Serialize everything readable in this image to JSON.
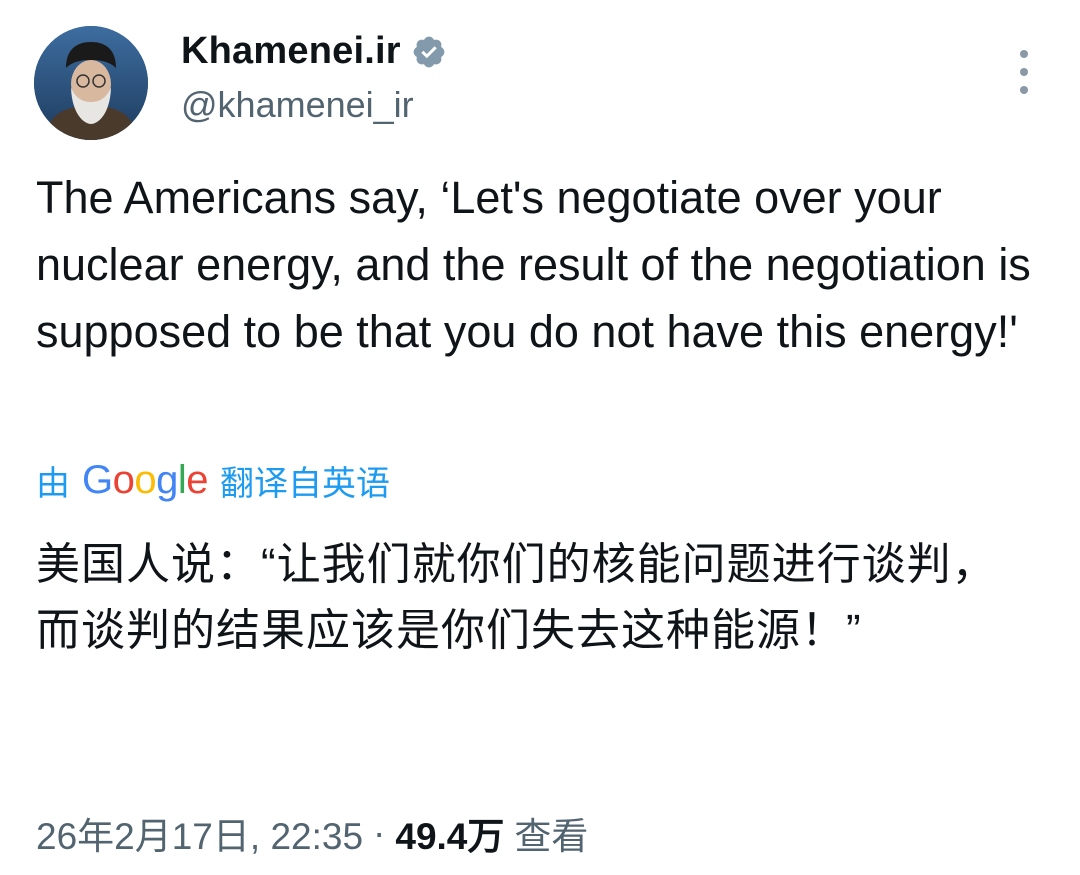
{
  "author": {
    "display_name": "Khamenei.ir",
    "handle": "@khamenei_ir",
    "verified_icon": "verified-badge-icon",
    "avatar": "profile-photo"
  },
  "tweet": {
    "text": "The Americans say, ‘Let's negotiate over your nuclear energy, and the result of the negotiation is supposed to be that you do not have this energy!'",
    "translate_prefix": "由",
    "translate_brand": "Google",
    "translate_suffix": "翻译自英语",
    "translated_text": "美国人说：“让我们就你们的核能问题进行谈判，而谈判的结果应该是你们失去这种能源！”"
  },
  "meta": {
    "timestamp": "26年2月17日, 22:35",
    "separator": "·",
    "views_count": "49.4万",
    "views_label": "查看"
  },
  "colors": {
    "text": "#0f1419",
    "secondary": "#536471",
    "link": "#1d9bf0"
  },
  "icons": {
    "more": "more-vertical-icon"
  }
}
